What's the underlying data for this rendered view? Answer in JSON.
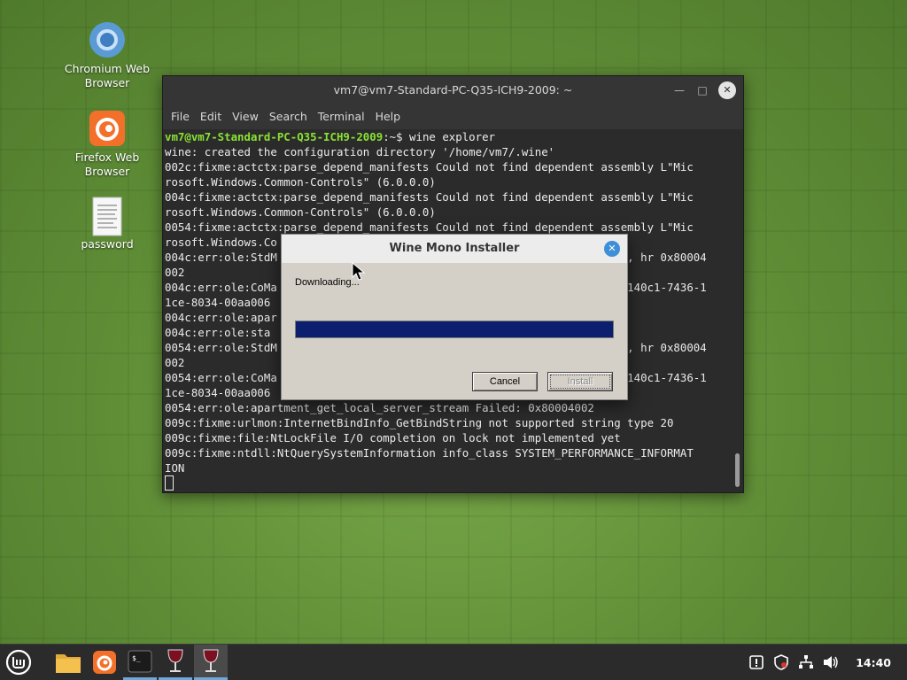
{
  "desktop": {
    "icons": [
      {
        "label": "Chromium Web Browser",
        "icon": "chromium-icon"
      },
      {
        "label": "Firefox Web Browser",
        "icon": "firefox-icon"
      },
      {
        "label": "password",
        "icon": "text-file-icon"
      }
    ]
  },
  "terminal": {
    "title": "vm7@vm7-Standard-PC-Q35-ICH9-2009: ~",
    "menu": [
      "File",
      "Edit",
      "View",
      "Search",
      "Terminal",
      "Help"
    ],
    "prompt_user": "vm7@vm7-Standard-PC-Q35-ICH9-2009",
    "prompt_suffix": ":~$ wine explorer",
    "lines": [
      "wine: created the configuration directory '/home/vm7/.wine'",
      "002c:fixme:actctx:parse_depend_manifests Could not find dependent assembly L\"Mic",
      "rosoft.Windows.Common-Controls\" (6.0.0.0)",
      "004c:fixme:actctx:parse_depend_manifests Could not find dependent assembly L\"Mic",
      "rosoft.Windows.Common-Controls\" (6.0.0.0)",
      "0054:fixme:actctx:parse_depend_manifests Could not find dependent assembly L\"Mic",
      "rosoft.Windows.Co",
      "004c:err:ole:StdM                                                  tub, hr 0x80004",
      "002",
      "004c:err:ole:CoMa                                                  6d5140c1-7436-1",
      "1ce-8034-00aa006",
      "004c:err:ole:apar",
      "004c:err:ole:sta",
      "0054:err:ole:StdM                                                  tub, hr 0x80004",
      "002",
      "0054:err:ole:CoMa                                                  6d5140c1-7436-1",
      "1ce-8034-00aa006",
      "0054:err:ole:apartment_get_local_server_stream Failed: 0x80004002",
      "009c:fixme:urlmon:InternetBindInfo_GetBindString not supported string type 20",
      "009c:fixme:file:NtLockFile I/O completion on lock not implemented yet",
      "009c:fixme:ntdll:NtQuerySystemInformation info_class SYSTEM_PERFORMANCE_INFORMAT",
      "ION"
    ]
  },
  "wine_dialog": {
    "title": "Wine Mono Installer",
    "status": "Downloading...",
    "progress_fraction": 1.0,
    "cancel_label": "Cancel",
    "install_label": "Install"
  },
  "taskbar": {
    "clock": "14:40",
    "items": [
      "mint-menu-icon",
      "files-icon",
      "firefox-icon",
      "terminal-icon",
      "wine-icon",
      "wine-icon"
    ]
  },
  "colors": {
    "progress": "#0b1f6e",
    "prompt": "#8ae234",
    "accent": "#3d8fd8"
  }
}
